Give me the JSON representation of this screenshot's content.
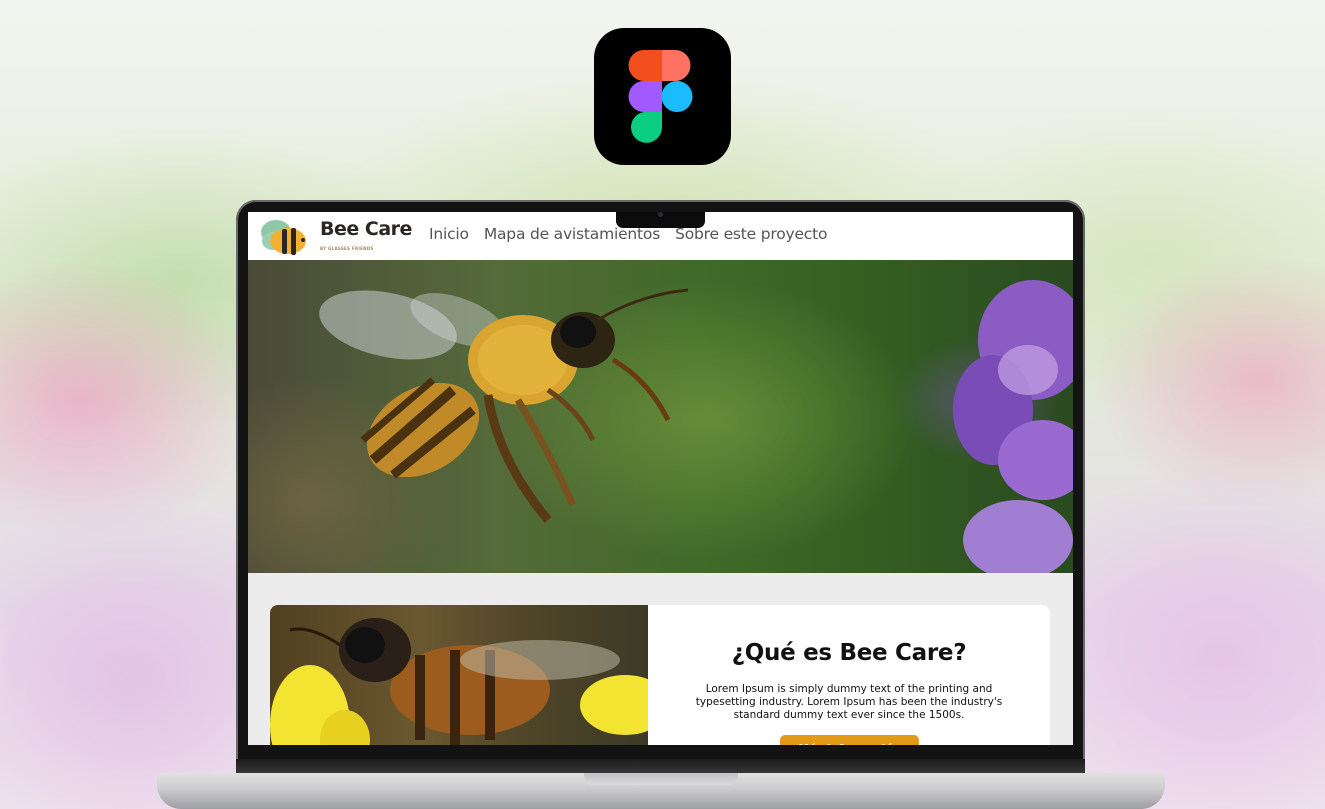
{
  "badge": {
    "icon": "figma-logo-icon"
  },
  "site": {
    "brand": "Bee Care",
    "tagline": "BY GLASSES FRIENDS",
    "logo_icon": "bee-logo-icon",
    "nav": [
      {
        "label": "Inicio"
      },
      {
        "label": "Mapa de avistamientos"
      },
      {
        "label": "Sobre este proyecto"
      }
    ]
  },
  "hero": {
    "image": "bee-flying-toward-purple-flower-photo"
  },
  "about": {
    "image": "bee-on-yellow-flower-photo",
    "title": "¿Qué es Bee Care?",
    "body": "Lorem Ipsum is simply dummy text of the printing and typesetting industry. Lorem Ipsum has been the industry's standard dummy text ever since the 1500s.",
    "button": "Más información"
  },
  "colors": {
    "accent": "#e39b17",
    "header_bg": "#ffffff",
    "page_bg": "#ececec"
  }
}
